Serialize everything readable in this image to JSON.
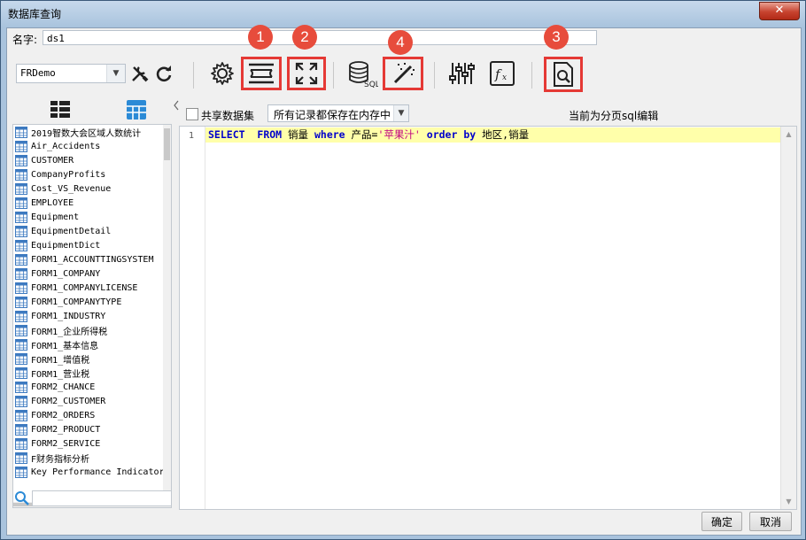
{
  "window": {
    "title": "数据库查询",
    "close_label": "✕"
  },
  "name_field": {
    "label": "名字:",
    "value": "ds1"
  },
  "connection": {
    "selected": "FRDemo"
  },
  "badges": [
    "1",
    "2",
    "4",
    "3"
  ],
  "tables": [
    "2019智数大会区域人数统计",
    "Air_Accidents",
    "CUSTOMER",
    "CompanyProfits",
    "Cost_VS_Revenue",
    "EMPLOYEE",
    "Equipment",
    "EquipmentDetail",
    "EquipmentDict",
    "FORM1_ACCOUNTTINGSYSTEM",
    "FORM1_COMPANY",
    "FORM1_COMPANYLICENSE",
    "FORM1_COMPANYTYPE",
    "FORM1_INDUSTRY",
    "FORM1_企业所得税",
    "FORM1_基本信息",
    "FORM1_增值税",
    "FORM1_营业税",
    "FORM2_CHANCE",
    "FORM2_CUSTOMER",
    "FORM2_ORDERS",
    "FORM2_PRODUCT",
    "FORM2_SERVICE",
    "F财务指标分析",
    "Key Performance Indicator"
  ],
  "options": {
    "share_label": "共享数据集",
    "cache_selected": "所有记录都保存在内存中",
    "mode_text": "当前为分页sql编辑"
  },
  "editor": {
    "line_number": "1",
    "sql": {
      "kw_select": "SELECT",
      "kw_from": "FROM",
      "table": "销量",
      "kw_where": "where",
      "field": "产品=",
      "literal": "'苹果汁'",
      "kw_order": "order",
      "kw_by": "by",
      "order_fields": "地区,销量"
    }
  },
  "buttons": {
    "ok": "确定",
    "cancel": "取消"
  },
  "colors": {
    "highlight_border": "#e53935",
    "badge": "#e74c3c",
    "keyword": "#0000cc",
    "string": "#c00080",
    "current_line": "#ffffaa"
  }
}
